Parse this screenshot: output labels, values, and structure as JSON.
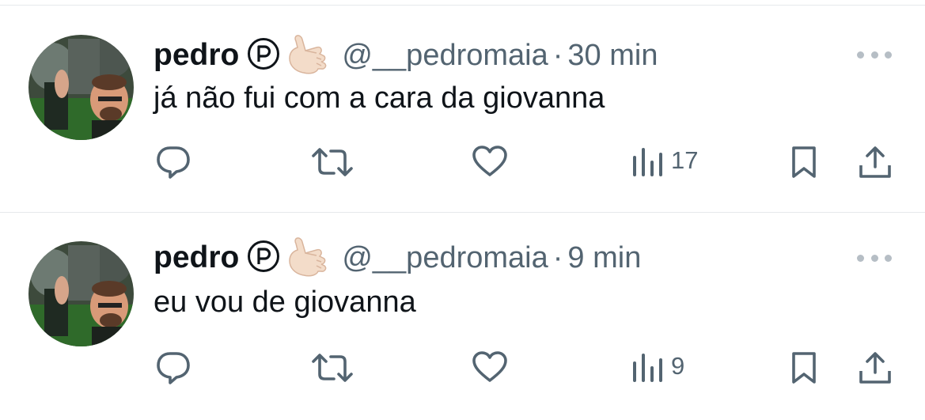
{
  "tweets": [
    {
      "name": "pedro",
      "handle": "@__pedromaia",
      "separator": "·",
      "time": "30 min",
      "text": "já não fui com a cara da giovanna",
      "views": "17"
    },
    {
      "name": "pedro",
      "handle": "@__pedromaia",
      "separator": "·",
      "time": "9 min",
      "text": "eu vou de giovanna",
      "views": "9"
    }
  ],
  "icons": {
    "badge": "circled-p-icon",
    "emoji": "call-me-hand-emoji",
    "reply": "reply-icon",
    "retweet": "retweet-icon",
    "like": "heart-icon",
    "views": "views-icon",
    "bookmark": "bookmark-icon",
    "share": "share-icon",
    "more": "more-icon"
  },
  "colors": {
    "text": "#0f1419",
    "secondary": "#536471",
    "divider": "#e6e9ec"
  }
}
